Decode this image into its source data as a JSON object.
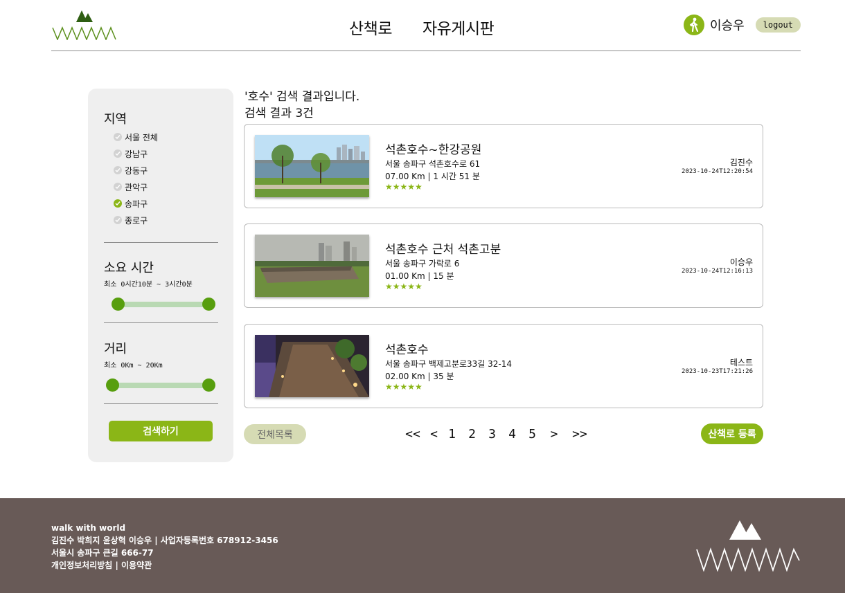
{
  "header": {
    "nav": [
      "산책로",
      "자유게시판"
    ],
    "user_name": "이승우",
    "logout_label": "logout"
  },
  "sidebar": {
    "region_title": "지역",
    "regions": [
      {
        "label": "서울 전체",
        "checked": false
      },
      {
        "label": "강남구",
        "checked": false
      },
      {
        "label": "강동구",
        "checked": false
      },
      {
        "label": "관악구",
        "checked": false
      },
      {
        "label": "송파구",
        "checked": true
      },
      {
        "label": "종로구",
        "checked": false
      }
    ],
    "time_title": "소요 시간",
    "time_range": "최소 0시간10분 ~ 3시간0분",
    "distance_title": "거리",
    "distance_range": "최소 0Km ~ 20Km",
    "search_label": "검색하기"
  },
  "results": {
    "query_line": "'호수' 검색 결과입니다.",
    "count_line": "검색 결과 3건",
    "items": [
      {
        "title": "석촌호수~한강공원",
        "address": "서울 송파구 석촌호수로 61",
        "info": "07.00 Km | 1 시간 51 분",
        "stars": "★★★★★",
        "author": "김진수",
        "date": "2023-10-24T12:20:54"
      },
      {
        "title": "석촌호수 근처 석촌고분",
        "address": "서울 송파구 가락로 6",
        "info": "01.00 Km | 15 분",
        "stars": "★★★★★",
        "author": "이승우",
        "date": "2023-10-24T12:16:13"
      },
      {
        "title": "석촌호수",
        "address": "서울 송파구 백제고분로33길 32-14",
        "info": "02.00 Km | 35 분",
        "stars": "★★★★★",
        "author": "테스트",
        "date": "2023-10-23T17:21:26"
      }
    ]
  },
  "controls": {
    "all_list_label": "전체목록",
    "pager": [
      "<<",
      "<",
      "1",
      "2",
      "3",
      "4",
      "5",
      ">",
      ">>"
    ],
    "register_label": "산책로 등록"
  },
  "footer": {
    "lines": [
      "walk with world",
      "김진수 박희지 윤상혁 이승우 | 사업자등록번호 678912-3456",
      "서울시 송파구 큰길 666-77",
      "개인정보처리방침 | 이용약관"
    ]
  },
  "colors": {
    "accent": "#8bb617",
    "logo_green": "#3f6f17",
    "footer_bg": "#685a57",
    "pill_bg": "#d6dbb4",
    "slider_track": "#b9d9b3",
    "slider_knob": "#579e0e"
  }
}
